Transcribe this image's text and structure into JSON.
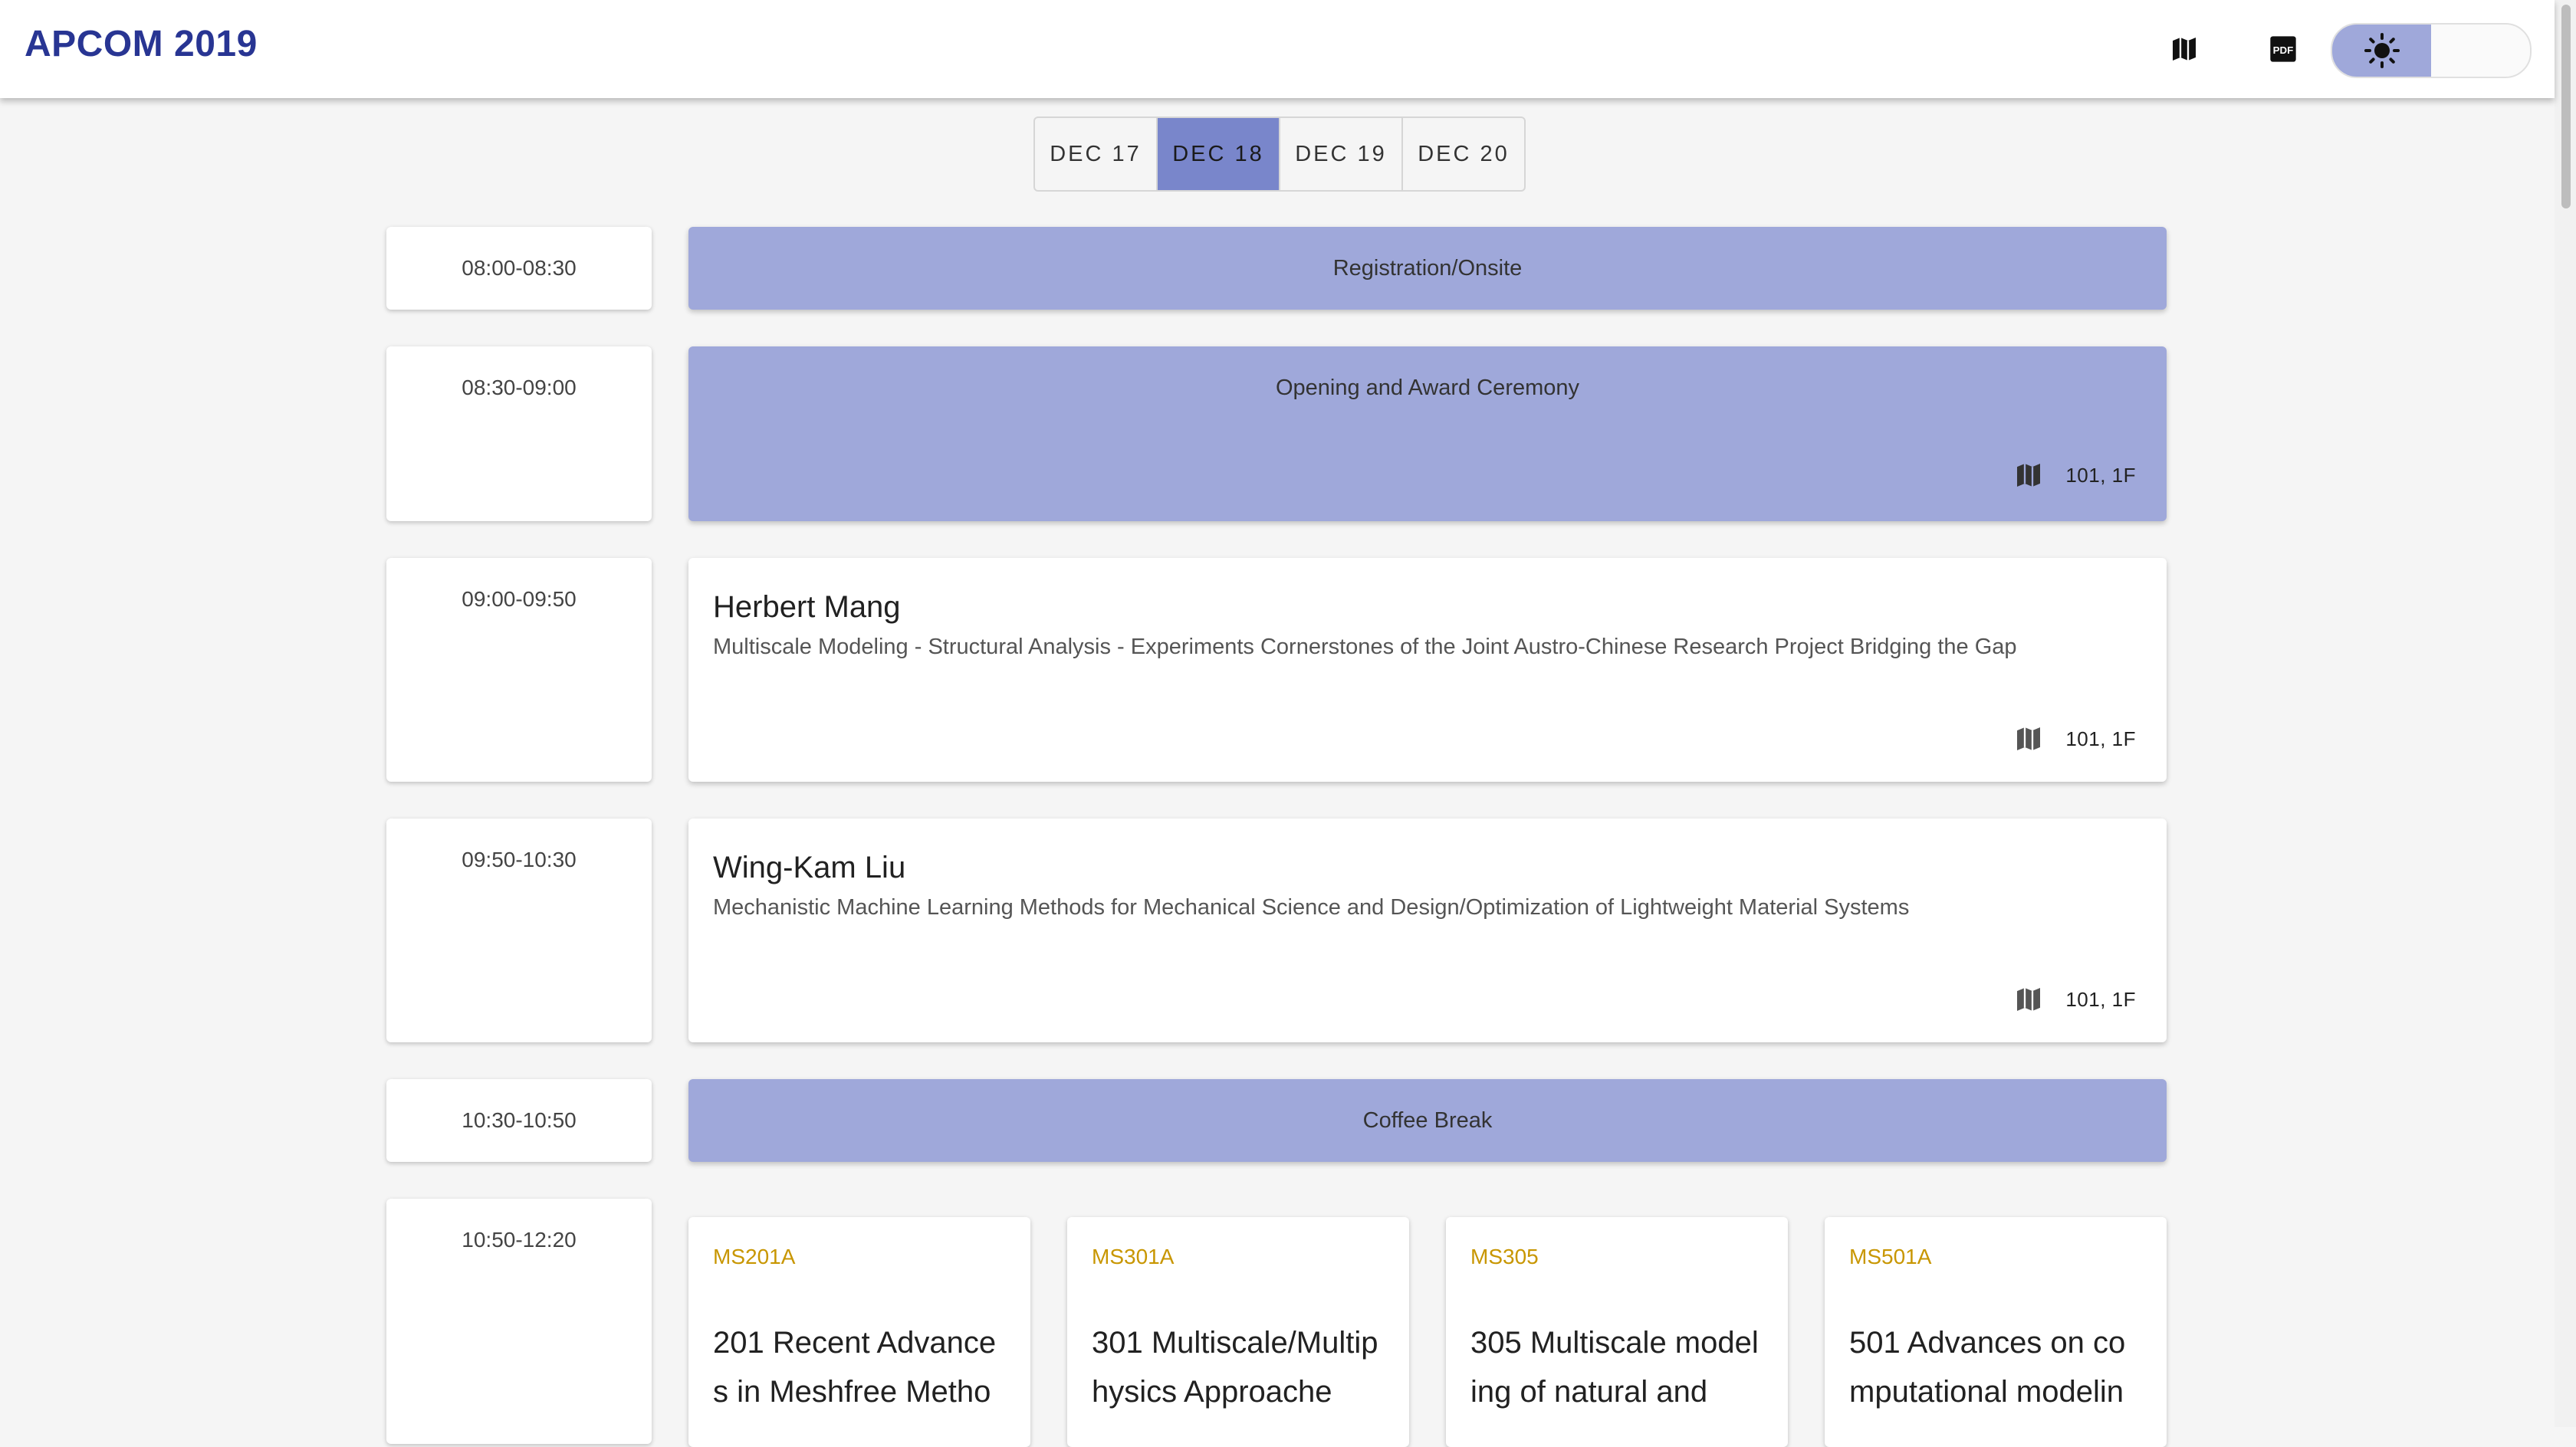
{
  "app": {
    "title": "APCOM 2019"
  },
  "appbar": {
    "map_icon": "map-icon",
    "pdf_icon": "pdf-icon",
    "light_icon": "sun-icon",
    "dark_icon": "moon-icon",
    "pdf_glyph_text": "PDF"
  },
  "day_tabs": [
    {
      "label": "DEC 17",
      "active": false
    },
    {
      "label": "DEC 18",
      "active": true
    },
    {
      "label": "DEC 19",
      "active": false
    },
    {
      "label": "DEC 20",
      "active": false
    }
  ],
  "schedule": [
    {
      "time": "08:00-08:30",
      "type": "general",
      "title": "Registration/Onsite"
    },
    {
      "time": "08:30-09:00",
      "type": "general",
      "title": "Opening and Award Ceremony",
      "location": "101, 1F"
    },
    {
      "time": "09:00-09:50",
      "type": "talk",
      "speaker": "Herbert Mang",
      "title": "Multiscale Modeling - Structural Analysis - Experiments Cornerstones of the Joint Austro-Chinese Research Project Bridging the Gap",
      "location": "101, 1F"
    },
    {
      "time": "09:50-10:30",
      "type": "talk",
      "speaker": "Wing-Kam Liu",
      "title": "Mechanistic Machine Learning Methods for Mechanical Science and Design/Optimization of Lightweight Material Systems",
      "location": "101, 1F"
    },
    {
      "time": "10:30-10:50",
      "type": "general",
      "title": "Coffee Break"
    },
    {
      "time": "10:50-12:20",
      "type": "sessions"
    }
  ],
  "sessions": [
    {
      "code": "MS201A",
      "title": "201 Recent Advances in Meshfree Metho"
    },
    {
      "code": "MS301A",
      "title": "301 Multiscale/Multiphysics Approache"
    },
    {
      "code": "MS305",
      "title": "305 Multiscale modeling of natural and"
    },
    {
      "code": "MS501A",
      "title": "501 Advances on computational modelin"
    }
  ],
  "colors": {
    "brand": "#283593",
    "accent": "#9fa8da",
    "tab_active": "#7986cb",
    "session_code": "#c89600"
  }
}
